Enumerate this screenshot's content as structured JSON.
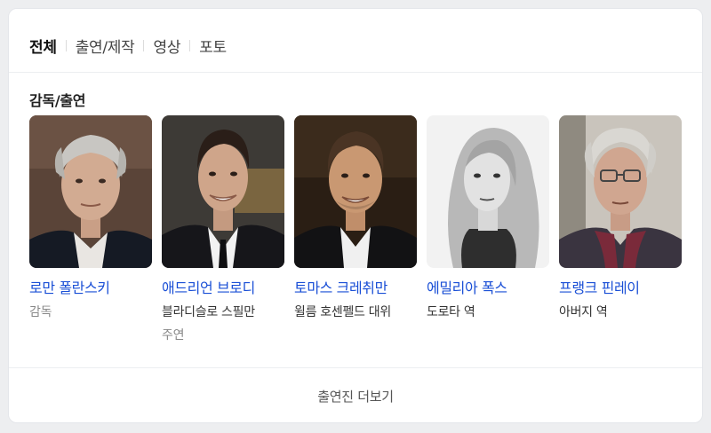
{
  "tabs": [
    {
      "label": "전체",
      "active": true
    },
    {
      "label": "출연/제작",
      "active": false
    },
    {
      "label": "영상",
      "active": false
    },
    {
      "label": "포토",
      "active": false
    }
  ],
  "section_title": "감독/출연",
  "people": [
    {
      "name": "로만 폴란스키",
      "role": "감독",
      "sub": "",
      "photo_style": "color"
    },
    {
      "name": "애드리언 브로디",
      "role": "블라디슬로 스필만",
      "sub": "주연",
      "photo_style": "color"
    },
    {
      "name": "토마스 크레취만",
      "role": "윌름 호센펠드 대위",
      "sub": "",
      "photo_style": "color"
    },
    {
      "name": "에밀리아 폭스",
      "role": "도로타 역",
      "sub": "",
      "photo_style": "grayscale"
    },
    {
      "name": "프랭크 핀레이",
      "role": "아버지 역",
      "sub": "",
      "photo_style": "color"
    }
  ],
  "more_label": "출연진 더보기",
  "colors": {
    "link": "#1a4fd6",
    "secondary_text": "#888888",
    "background": "#edeef0"
  }
}
